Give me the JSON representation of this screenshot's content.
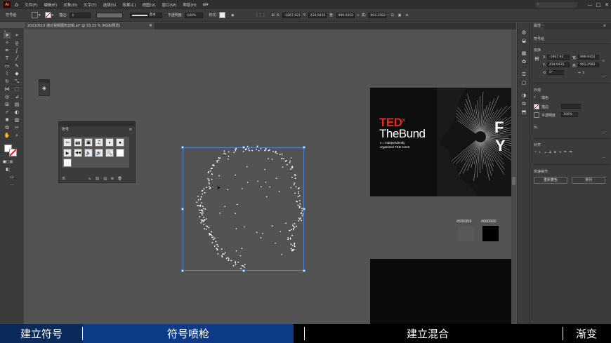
{
  "app": {
    "logo": "Ai",
    "menus": [
      "文件(F)",
      "编辑(E)",
      "对象(O)",
      "文字(T)",
      "选择(S)",
      "效果(C)",
      "视图(V)",
      "窗口(W)",
      "帮助(H)"
    ],
    "window_controls": [
      "—",
      "□",
      "✕"
    ]
  },
  "control_bar": {
    "selection_label": "符号组",
    "stroke_label": "描边:",
    "stroke_style": "基本",
    "opacity_label": "不透明度:",
    "opacity_value": "100%",
    "style_label": "样式:",
    "x_label": "X:",
    "x_value": "-1867.921",
    "y_label": "Y:",
    "y_value": "434.0435",
    "w_label": "宽:",
    "w_value": "999.9352",
    "h_label": "高:",
    "h_value": "903.2582"
  },
  "document_tab": {
    "title": "20210510 通过视频图形剪辑.ai* @ 33.33 % (RGB/预览)",
    "close": "✕"
  },
  "symbol_panel": {
    "title": "符号",
    "symbols": [
      "⇦",
      "📷",
      "▣",
      "♫",
      "⏸",
      "⏹",
      "▶",
      "◀◀",
      "🔈",
      "🔊",
      "🔍",
      ""
    ],
    "footer": "ⅠⅠⅠ."
  },
  "properties_panel": {
    "tab": "属性",
    "object_type": "符号组",
    "transform_label": "变换",
    "x_label": "X:",
    "x_value": "-1867.92",
    "y_label": "Y:",
    "y_value": "434.0435",
    "w_label": "宽:",
    "w_value": "999.9352",
    "h_label": "高:",
    "h_value": "903.2582",
    "rotate_value": "0°",
    "appearance_label": "外观",
    "fill_label": "填色",
    "stroke_label": "描边",
    "opacity_label": "不透明度",
    "opacity_value": "100%",
    "fx_label": "fx.",
    "align_label": "对齐",
    "quick_actions_label": "快速操作",
    "recolor_button": "重新着色",
    "arrange_button": "排列"
  },
  "artboard": {
    "brand": "TED",
    "brand_sup": "x",
    "title": "TheBund",
    "tagline1": "x = independently",
    "tagline2": "organized TED event",
    "letter1": "F",
    "letter2": "Y"
  },
  "swatches": [
    {
      "label": "#595959",
      "color": "#595959"
    },
    {
      "label": "#000000",
      "color": "#000000"
    }
  ],
  "subtitle_bar": {
    "segments": [
      {
        "text": "建立符号",
        "bg": "#0a2a5c"
      },
      {
        "text": "符号喷枪",
        "bg": "#0d3b85"
      },
      {
        "text": "建立混合",
        "bg": "#000000"
      },
      {
        "text": "渐变",
        "bg": "#000000"
      }
    ]
  }
}
